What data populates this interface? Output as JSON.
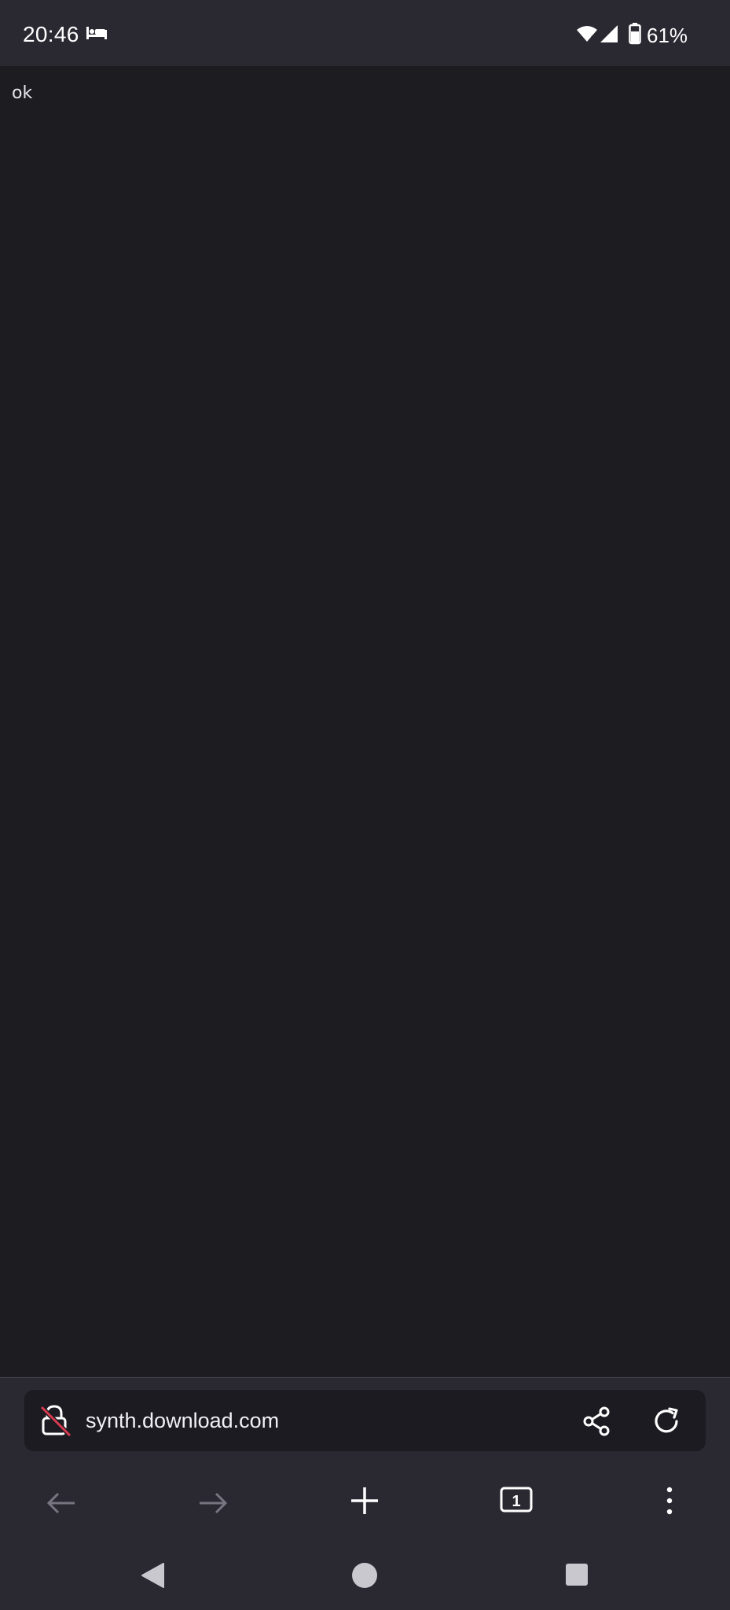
{
  "status_bar": {
    "time": "20:46",
    "notification_icon": "bed-icon",
    "battery_percent": "61%",
    "wifi_label": "4"
  },
  "page": {
    "body_text": "ok"
  },
  "address_bar": {
    "url": "synth.download.com",
    "lock_state": "insecure"
  },
  "toolbar": {
    "tab_count": "1"
  },
  "colors": {
    "background": "#1d1c21",
    "toolbar": "#2a2932",
    "insecure_slash": "#d93b4f"
  }
}
